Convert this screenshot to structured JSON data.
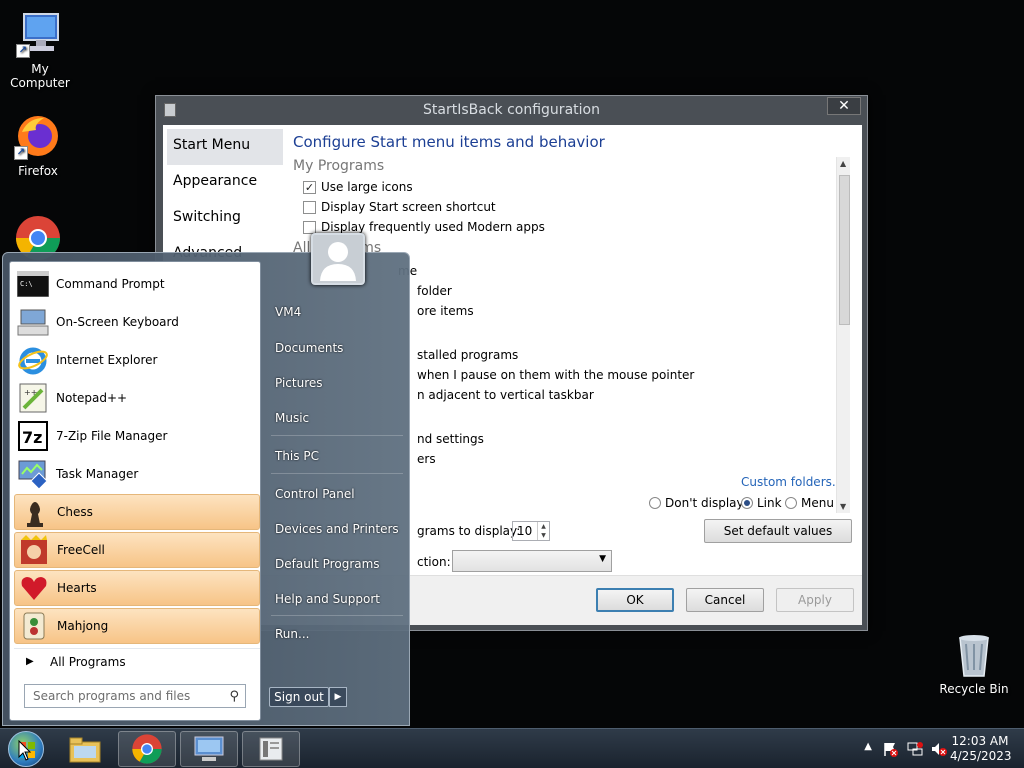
{
  "desktop": {
    "icons": [
      {
        "label": "My Computer",
        "icon": "computer-icon"
      },
      {
        "label": "Firefox",
        "icon": "firefox-icon"
      },
      {
        "label": "Chrome",
        "icon": "chrome-icon"
      },
      {
        "label": "Recycle Bin",
        "icon": "recycle-bin-icon"
      }
    ]
  },
  "config_window": {
    "title": "StartIsBack configuration",
    "close_label": "✕",
    "nav": [
      "Start Menu",
      "Appearance",
      "Switching",
      "Advanced"
    ],
    "heading": "Configure Start menu items and behavior",
    "section_my_programs": "My Programs",
    "opt_large_icons": "Use large icons",
    "opt_large_icons_checked": true,
    "opt_start_screen": "Display Start screen shortcut",
    "opt_modern_apps": "Display frequently used Modern apps",
    "section_all_programs": "All Programs",
    "partial_1": "me",
    "partial_2": "folder",
    "partial_3": "ore items",
    "partial_4": "stalled programs",
    "partial_5": "when I pause on them with the mouse pointer",
    "partial_6": "n adjacent to vertical taskbar",
    "partial_7": "nd settings",
    "partial_8": "ers",
    "custom_folders": "Custom folders...",
    "radio_dont_display": "Don't display",
    "radio_link": "Link",
    "radio_menu": "Menu",
    "recent_programs_label": "grams to display:",
    "recent_programs_value": "10",
    "set_default": "Set default values",
    "power_action_label": "ction:",
    "ok": "OK",
    "cancel": "Cancel",
    "apply": "Apply"
  },
  "start_menu": {
    "programs": [
      {
        "label": "Command Prompt",
        "icon": "command-prompt-icon",
        "highlighted": false
      },
      {
        "label": "On-Screen Keyboard",
        "icon": "keyboard-icon",
        "highlighted": false
      },
      {
        "label": "Internet Explorer",
        "icon": "internet-explorer-icon",
        "highlighted": false
      },
      {
        "label": "Notepad++",
        "icon": "notepad-plus-plus-icon",
        "highlighted": false
      },
      {
        "label": "7-Zip File Manager",
        "icon": "seven-zip-icon",
        "highlighted": false
      },
      {
        "label": "Task Manager",
        "icon": "task-manager-icon",
        "highlighted": false
      },
      {
        "label": "Chess",
        "icon": "chess-icon",
        "highlighted": true
      },
      {
        "label": "FreeCell",
        "icon": "freecell-icon",
        "highlighted": true
      },
      {
        "label": "Hearts",
        "icon": "hearts-icon",
        "highlighted": true
      },
      {
        "label": "Mahjong",
        "icon": "mahjong-icon",
        "highlighted": true
      }
    ],
    "all_programs": "All Programs",
    "search_placeholder": "Search programs and files",
    "right_items": [
      "VM4",
      "Documents",
      "Pictures",
      "Music",
      "This PC",
      "Control Panel",
      "Devices and Printers",
      "Default Programs",
      "Help and Support",
      "Run..."
    ],
    "sign_out": "Sign out"
  },
  "taskbar": {
    "pinned": [
      "explorer-icon",
      "chrome-icon",
      "remote-desktop-icon",
      "startisback-config-icon"
    ],
    "time": "12:03 AM",
    "date": "4/25/2023"
  }
}
